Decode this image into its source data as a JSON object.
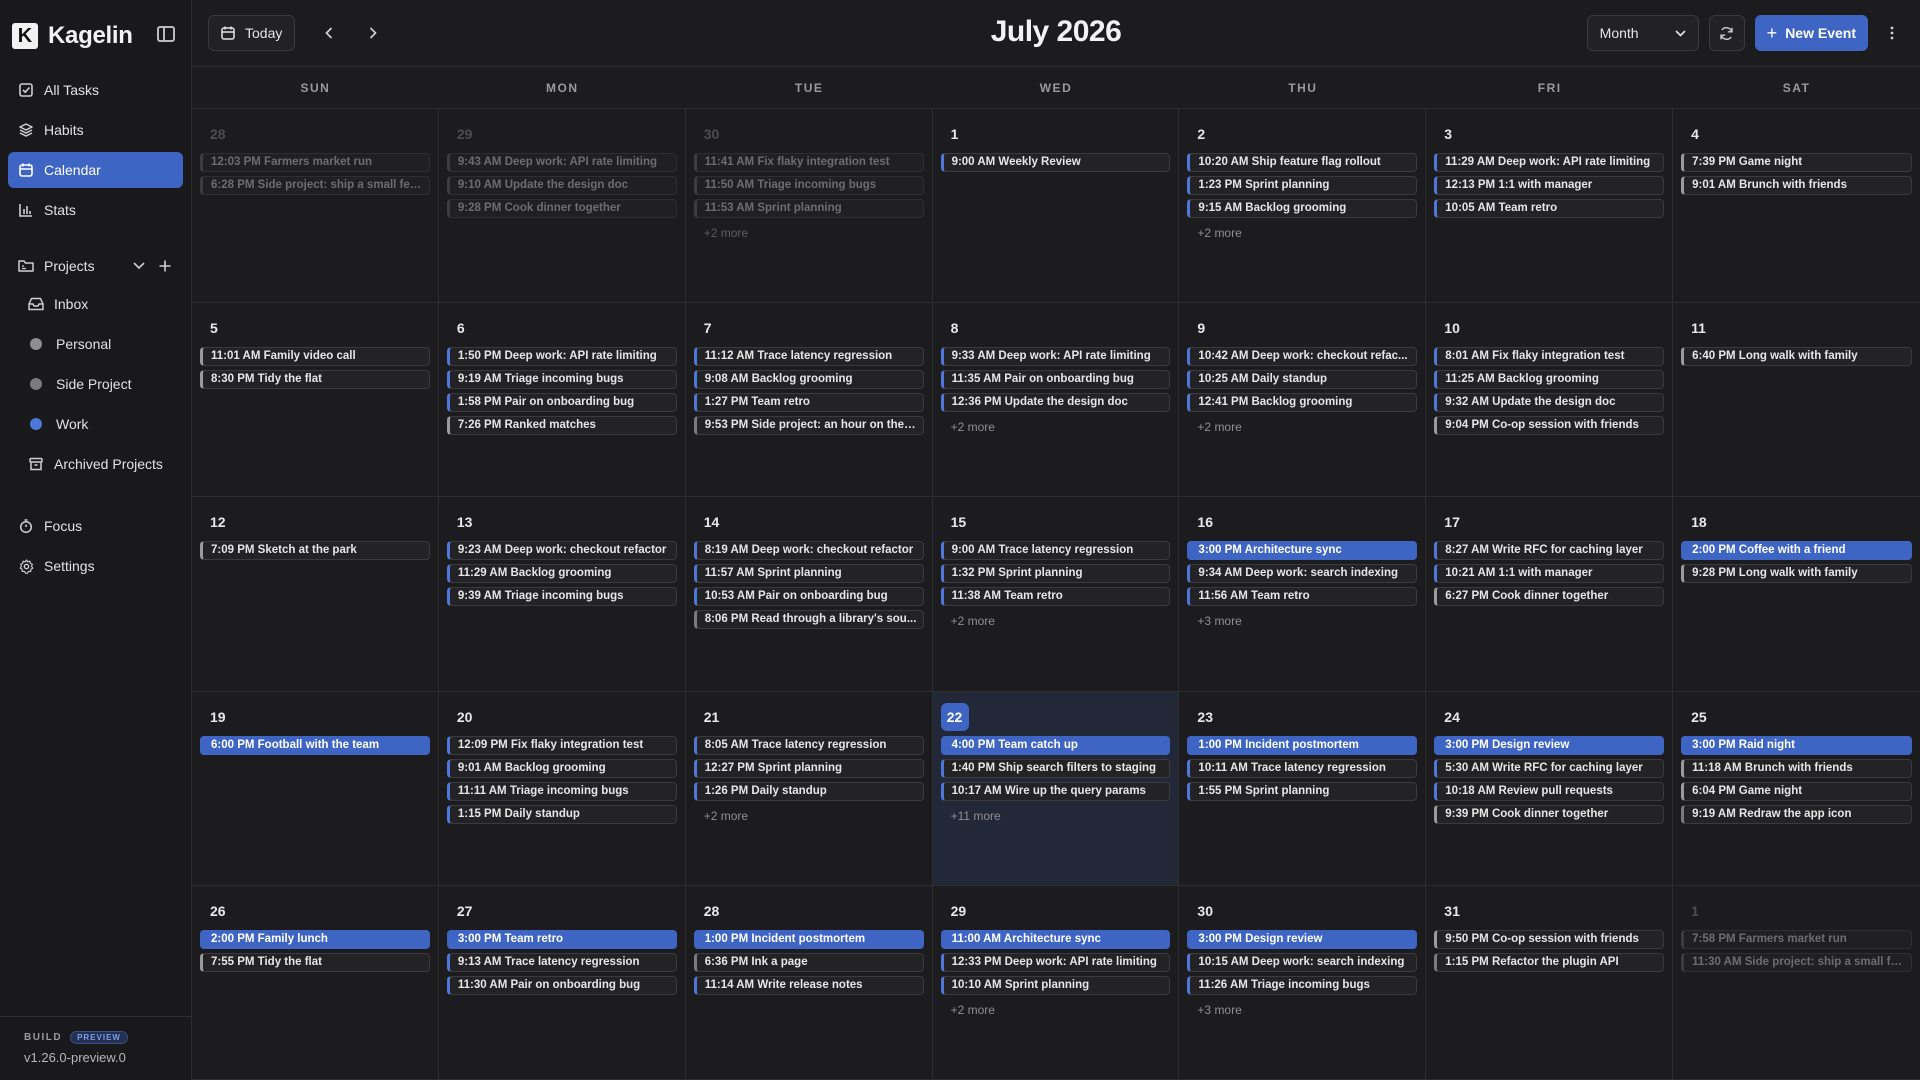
{
  "app": {
    "name": "Kagelin",
    "logo_letter": "K"
  },
  "sidebar": {
    "nav": [
      {
        "label": "All Tasks",
        "icon": "checkbox-icon",
        "active": false
      },
      {
        "label": "Habits",
        "icon": "layers-icon",
        "active": false
      },
      {
        "label": "Calendar",
        "icon": "calendar-icon",
        "active": true
      },
      {
        "label": "Stats",
        "icon": "bar-chart-icon",
        "active": false
      }
    ],
    "projects_label": "Projects",
    "projects": [
      {
        "label": "Inbox",
        "icon": "inbox-icon"
      },
      {
        "label": "Personal",
        "dot_color": "#9a9a9a"
      },
      {
        "label": "Side Project",
        "dot_color": "#8a8a8a"
      },
      {
        "label": "Work",
        "dot_color": "#4f77d9"
      },
      {
        "label": "Archived Projects",
        "icon": "archive-icon"
      }
    ],
    "bottom": [
      {
        "label": "Focus",
        "icon": "timer-icon"
      },
      {
        "label": "Settings",
        "icon": "gear-icon"
      }
    ],
    "build": {
      "label": "BUILD",
      "badge": "PREVIEW",
      "version": "v1.26.0-preview.0"
    }
  },
  "toolbar": {
    "today_label": "Today",
    "title": "July 2026",
    "view_select": "Month",
    "new_event_label": "New Event"
  },
  "colors": {
    "accent": "#3e64c4",
    "work": "#4f77d9",
    "personal": "#9a9a9a",
    "side": "#7b7b7f"
  },
  "weekdays": [
    "SUN",
    "MON",
    "TUE",
    "WED",
    "THU",
    "FRI",
    "SAT"
  ],
  "days": [
    {
      "num": "28",
      "out": true,
      "events": [
        {
          "text": "12:03 PM Farmers market run",
          "cat": "personal"
        },
        {
          "text": "6:28 PM Side project: ship a small fea...",
          "cat": "side"
        }
      ]
    },
    {
      "num": "29",
      "out": true,
      "events": [
        {
          "text": "9:43 AM Deep work: API rate limiting",
          "cat": "work"
        },
        {
          "text": "9:10 AM Update the design doc",
          "cat": "work"
        },
        {
          "text": "9:28 PM Cook dinner together",
          "cat": "personal"
        }
      ]
    },
    {
      "num": "30",
      "out": true,
      "events": [
        {
          "text": "11:41 AM Fix flaky integration test",
          "cat": "work"
        },
        {
          "text": "11:50 AM Triage incoming bugs",
          "cat": "work"
        },
        {
          "text": "11:53 AM Sprint planning",
          "cat": "work"
        }
      ],
      "more": "+2 more"
    },
    {
      "num": "1",
      "events": [
        {
          "text": "9:00 AM Weekly Review",
          "cat": "work"
        }
      ]
    },
    {
      "num": "2",
      "events": [
        {
          "text": "10:20 AM Ship feature flag rollout",
          "cat": "work"
        },
        {
          "text": "1:23 PM Sprint planning",
          "cat": "work"
        },
        {
          "text": "9:15 AM Backlog grooming",
          "cat": "work"
        }
      ],
      "more": "+2 more"
    },
    {
      "num": "3",
      "events": [
        {
          "text": "11:29 AM Deep work: API rate limiting",
          "cat": "work"
        },
        {
          "text": "12:13 PM 1:1 with manager",
          "cat": "work"
        },
        {
          "text": "10:05 AM Team retro",
          "cat": "work"
        }
      ]
    },
    {
      "num": "4",
      "events": [
        {
          "text": "7:39 PM Game night",
          "cat": "personal"
        },
        {
          "text": "9:01 AM Brunch with friends",
          "cat": "personal"
        }
      ]
    },
    {
      "num": "5",
      "events": [
        {
          "text": "11:01 AM Family video call",
          "cat": "personal"
        },
        {
          "text": "8:30 PM Tidy the flat",
          "cat": "personal"
        }
      ]
    },
    {
      "num": "6",
      "events": [
        {
          "text": "1:50 PM Deep work: API rate limiting",
          "cat": "work"
        },
        {
          "text": "9:19 AM Triage incoming bugs",
          "cat": "work"
        },
        {
          "text": "1:58 PM Pair on onboarding bug",
          "cat": "work"
        },
        {
          "text": "7:26 PM Ranked matches",
          "cat": "personal"
        }
      ]
    },
    {
      "num": "7",
      "events": [
        {
          "text": "11:12 AM Trace latency regression",
          "cat": "work"
        },
        {
          "text": "9:08 AM Backlog grooming",
          "cat": "work"
        },
        {
          "text": "1:27 PM Team retro",
          "cat": "work"
        },
        {
          "text": "9:53 PM Side project: an hour on the ...",
          "cat": "side"
        }
      ]
    },
    {
      "num": "8",
      "events": [
        {
          "text": "9:33 AM Deep work: API rate limiting",
          "cat": "work"
        },
        {
          "text": "11:35 AM Pair on onboarding bug",
          "cat": "work"
        },
        {
          "text": "12:36 PM Update the design doc",
          "cat": "work"
        }
      ],
      "more": "+2 more"
    },
    {
      "num": "9",
      "events": [
        {
          "text": "10:42 AM Deep work: checkout refac...",
          "cat": "work"
        },
        {
          "text": "10:25 AM Daily standup",
          "cat": "work"
        },
        {
          "text": "12:41 PM Backlog grooming",
          "cat": "work"
        }
      ],
      "more": "+2 more"
    },
    {
      "num": "10",
      "events": [
        {
          "text": "8:01 AM Fix flaky integration test",
          "cat": "work"
        },
        {
          "text": "11:25 AM Backlog grooming",
          "cat": "work"
        },
        {
          "text": "9:32 AM Update the design doc",
          "cat": "work"
        },
        {
          "text": "9:04 PM Co-op session with friends",
          "cat": "personal"
        }
      ]
    },
    {
      "num": "11",
      "events": [
        {
          "text": "6:40 PM Long walk with family",
          "cat": "personal"
        }
      ]
    },
    {
      "num": "12",
      "events": [
        {
          "text": "7:09 PM Sketch at the park",
          "cat": "personal"
        }
      ]
    },
    {
      "num": "13",
      "events": [
        {
          "text": "9:23 AM Deep work: checkout refactor",
          "cat": "work"
        },
        {
          "text": "11:29 AM Backlog grooming",
          "cat": "work"
        },
        {
          "text": "9:39 AM Triage incoming bugs",
          "cat": "work"
        }
      ]
    },
    {
      "num": "14",
      "events": [
        {
          "text": "8:19 AM Deep work: checkout refactor",
          "cat": "work"
        },
        {
          "text": "11:57 AM Sprint planning",
          "cat": "work"
        },
        {
          "text": "10:53 AM Pair on onboarding bug",
          "cat": "work"
        },
        {
          "text": "8:06 PM Read through a library's sou...",
          "cat": "side"
        }
      ]
    },
    {
      "num": "15",
      "events": [
        {
          "text": "9:00 AM Trace latency regression",
          "cat": "work"
        },
        {
          "text": "1:32 PM Sprint planning",
          "cat": "work"
        },
        {
          "text": "11:38 AM Team retro",
          "cat": "work"
        }
      ],
      "more": "+2 more"
    },
    {
      "num": "16",
      "events": [
        {
          "text": "3:00 PM Architecture sync",
          "cat": "hl"
        },
        {
          "text": "9:34 AM Deep work: search indexing",
          "cat": "work"
        },
        {
          "text": "11:56 AM Team retro",
          "cat": "work"
        }
      ],
      "more": "+3 more"
    },
    {
      "num": "17",
      "events": [
        {
          "text": "8:27 AM Write RFC for caching layer",
          "cat": "work"
        },
        {
          "text": "10:21 AM 1:1 with manager",
          "cat": "work"
        },
        {
          "text": "6:27 PM Cook dinner together",
          "cat": "personal"
        }
      ]
    },
    {
      "num": "18",
      "events": [
        {
          "text": "2:00 PM Coffee with a friend",
          "cat": "hl"
        },
        {
          "text": "9:28 PM Long walk with family",
          "cat": "personal"
        }
      ]
    },
    {
      "num": "19",
      "events": [
        {
          "text": "6:00 PM Football with the team",
          "cat": "hl"
        }
      ]
    },
    {
      "num": "20",
      "events": [
        {
          "text": "12:09 PM Fix flaky integration test",
          "cat": "work"
        },
        {
          "text": "9:01 AM Backlog grooming",
          "cat": "work"
        },
        {
          "text": "11:11 AM Triage incoming bugs",
          "cat": "work"
        },
        {
          "text": "1:15 PM Daily standup",
          "cat": "work"
        }
      ]
    },
    {
      "num": "21",
      "events": [
        {
          "text": "8:05 AM Trace latency regression",
          "cat": "work"
        },
        {
          "text": "12:27 PM Sprint planning",
          "cat": "work"
        },
        {
          "text": "1:26 PM Daily standup",
          "cat": "work"
        }
      ],
      "more": "+2 more"
    },
    {
      "num": "22",
      "today": true,
      "events": [
        {
          "text": "4:00 PM Team catch up",
          "cat": "hl"
        },
        {
          "text": "1:40 PM Ship search filters to staging",
          "cat": "work"
        },
        {
          "text": "10:17 AM Wire up the query params",
          "cat": "work"
        }
      ],
      "more": "+11 more"
    },
    {
      "num": "23",
      "events": [
        {
          "text": "1:00 PM Incident postmortem",
          "cat": "hl"
        },
        {
          "text": "10:11 AM Trace latency regression",
          "cat": "work"
        },
        {
          "text": "1:55 PM Sprint planning",
          "cat": "work"
        }
      ]
    },
    {
      "num": "24",
      "events": [
        {
          "text": "3:00 PM Design review",
          "cat": "hl"
        },
        {
          "text": "5:30 AM Write RFC for caching layer",
          "cat": "work"
        },
        {
          "text": "10:18 AM Review pull requests",
          "cat": "work"
        },
        {
          "text": "9:39 PM Cook dinner together",
          "cat": "personal"
        }
      ]
    },
    {
      "num": "25",
      "events": [
        {
          "text": "3:00 PM Raid night",
          "cat": "hl"
        },
        {
          "text": "11:18 AM Brunch with friends",
          "cat": "personal"
        },
        {
          "text": "6:04 PM Game night",
          "cat": "personal"
        },
        {
          "text": "9:19 AM Redraw the app icon",
          "cat": "side"
        }
      ]
    },
    {
      "num": "26",
      "events": [
        {
          "text": "2:00 PM Family lunch",
          "cat": "hl"
        },
        {
          "text": "7:55 PM Tidy the flat",
          "cat": "personal"
        }
      ]
    },
    {
      "num": "27",
      "events": [
        {
          "text": "3:00 PM Team retro",
          "cat": "hl"
        },
        {
          "text": "9:13 AM Trace latency regression",
          "cat": "work"
        },
        {
          "text": "11:30 AM Pair on onboarding bug",
          "cat": "work"
        }
      ]
    },
    {
      "num": "28",
      "events": [
        {
          "text": "1:00 PM Incident postmortem",
          "cat": "hl"
        },
        {
          "text": "6:36 PM Ink a page",
          "cat": "side"
        },
        {
          "text": "11:14 AM Write release notes",
          "cat": "work"
        }
      ]
    },
    {
      "num": "29",
      "events": [
        {
          "text": "11:00 AM Architecture sync",
          "cat": "hl"
        },
        {
          "text": "12:33 PM Deep work: API rate limiting",
          "cat": "work"
        },
        {
          "text": "10:10 AM Sprint planning",
          "cat": "work"
        }
      ],
      "more": "+2 more"
    },
    {
      "num": "30",
      "events": [
        {
          "text": "3:00 PM Design review",
          "cat": "hl"
        },
        {
          "text": "10:15 AM Deep work: search indexing",
          "cat": "work"
        },
        {
          "text": "11:26 AM Triage incoming bugs",
          "cat": "work"
        }
      ],
      "more": "+3 more"
    },
    {
      "num": "31",
      "events": [
        {
          "text": "9:50 PM Co-op session with friends",
          "cat": "personal"
        },
        {
          "text": "1:15 PM Refactor the plugin API",
          "cat": "side"
        }
      ]
    },
    {
      "num": "1",
      "out": true,
      "events": [
        {
          "text": "7:58 PM Farmers market run",
          "cat": "personal"
        },
        {
          "text": "11:30 AM Side project: ship a small fe...",
          "cat": "side"
        }
      ]
    }
  ]
}
